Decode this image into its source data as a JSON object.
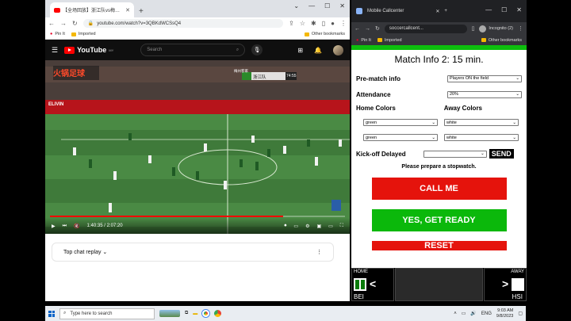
{
  "left_window": {
    "tab_title": "【全场回放】浙江队vs梅州客家 2023...",
    "address": "youtube.com/watch?v=3QBKdWCSsQ4",
    "bookmarks": {
      "item1": "Pin It",
      "item2": "Imported",
      "other": "Other bookmarks"
    },
    "youtube": {
      "logo_text": "YouTube",
      "region": "MY",
      "search_placeholder": "Search",
      "video": {
        "broadcaster": "火锅足球",
        "current_time": "1:40:35",
        "duration": "2:07:20",
        "progress": 0.79,
        "score_team1": "梅州客家",
        "score_team2": "浙江队",
        "clock": "74:55",
        "sponsor": "ELIVIN"
      },
      "chat_label": "Top chat replay"
    }
  },
  "right_window": {
    "tab_title": "Mobile Callcenter",
    "address": "soccercallcent...",
    "incognito": "Incognito (2)",
    "bookmarks": {
      "item1": "Pin It",
      "item2": "Imported",
      "other": "Other bookmarks"
    },
    "callcenter": {
      "title": "Match Info 2: 15 min.",
      "prematch_label": "Pre-match info",
      "prematch_value": "Players ON the field",
      "attendance_label": "Attendance",
      "attendance_value": "20%",
      "home_colors_label": "Home Colors",
      "away_colors_label": "Away Colors",
      "home_color_1": "green",
      "home_color_2": "green",
      "away_color_1": "white",
      "away_color_2": "white",
      "kickoff_label": "Kick-off Delayed",
      "kickoff_value": "",
      "send_label": "SEND",
      "stopwatch_note": "Please prepare a stopwatch.",
      "call_me": "CALL ME",
      "yes_ready": "YES, GET READY",
      "reset": "RESET"
    },
    "scoreboard": {
      "home_label": "HOME",
      "away_label": "AWAY",
      "home_team": "BEI",
      "away_team": "HSI",
      "home_color": "#0a7a0a",
      "away_color": "#ffffff"
    }
  },
  "taskbar": {
    "search_placeholder": "Type here to search",
    "lang": "ENG",
    "time": "9:03 AM",
    "date": "9/8/2023"
  }
}
